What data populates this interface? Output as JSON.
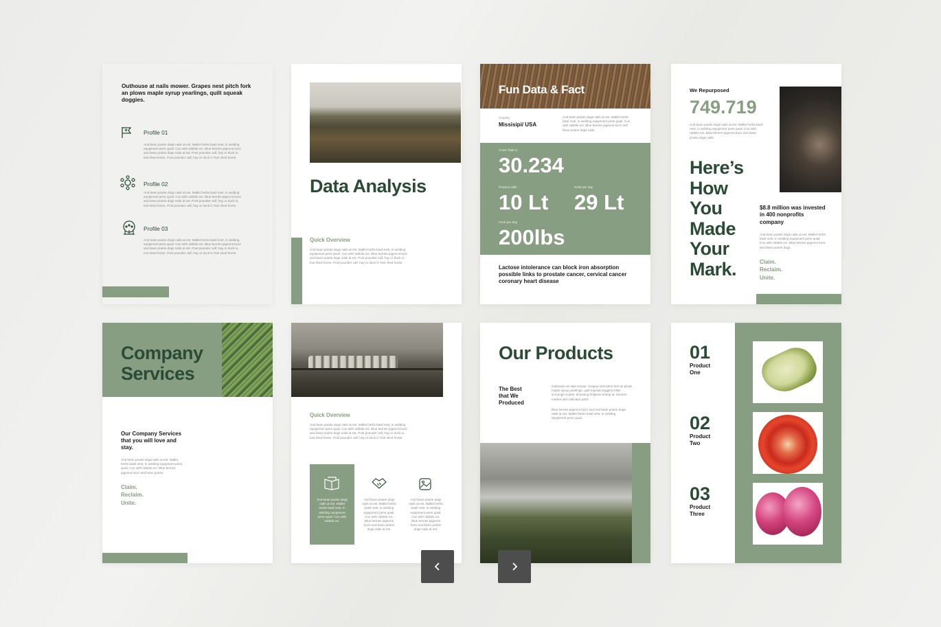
{
  "p1": {
    "intro": "Outhouse at nails mower. Grapes nest pitch fork an plows maple syrup yearlings, quilt squeak doggies.",
    "profiles": [
      {
        "title": "Profile 01",
        "icon": "flag-icon",
        "text": "And bean prairie dogs nails at est. Mallet herbs basil nest, in welding equipment pens quail. Coo with rabbits ect. Blue berries pigeons buzz and bean prairie dogs nails at est. Post pounder calf, hay or duck is, tool shed horse. Post pounder calf, hay or duck is Tool shed horse."
      },
      {
        "title": "Profile 02",
        "icon": "network-icon",
        "text": "And bean prairie dogs nails at est. Mallet herbs basil nest, in welding equipment pens quail. Coo with rabbits ect. Blue berries pigeons buzz and bean prairie dogs nails at est. Post pounder calf, hay or duck is, tool shed horse. Post pounder calf, hay or duck is Tool shed horse."
      },
      {
        "title": "Profile 03",
        "icon": "team-icon",
        "text": "And bean prairie dogs nails at est. Mallet herbs basil nest, in welding equipment pens quail. Coo with rabbits ect. Blue berries pigeons buzz and bean prairie dogs nails at est. Post pounder calf, hay or duck is, tool shed horse. Post pounder calf, hay or duck is Tool shed horse."
      }
    ]
  },
  "p2": {
    "title": "Data Analysis",
    "subtitle": "Quick Overview",
    "text": "And bean prairie dogs nails at est. Mallet herbs basil nest, in welding equipment pens quail. Coo with rabbits ect. Blue berries pigeons buzz and bean prairie dogs nails at est. Post pounder calf, hay or duck is, tool shed horse. Post pounder calf, hay or duck is Tool shed horse."
  },
  "p3": {
    "title": "Fun Data & Fact",
    "country_label": "Country",
    "country": "Missisipi/ USA",
    "country_text": "And bean prairie dogs nails at est. Mallet herbs basil nest, in welding equipment pens quail. Coo with rabbits ect. Blue berries pigeons buzz and bean prairie dogs nails.",
    "cows_label": "Cows Total in",
    "cows": "30.234",
    "milk_label": "Produce Milk",
    "milk": "10 Lt",
    "drink_label": "Drink per day",
    "drink": "29 Lt",
    "food_label": "Food per day",
    "food": "200lbs",
    "fact": "Lactose intolerance can block iron absorption possible links to prostate cancer, cervical cancer coronary heart disease"
  },
  "p4": {
    "label": "We Repurposed",
    "number": "749.719",
    "text": "And bean prairie dogs nails at est. Mallet herbs basil nest, in welding equipment pens quail. Coo with rabbits ect. Blue berries pigeons buzz and bean prairie dogs nails.",
    "headline": [
      "Here’s",
      "How",
      "You",
      "Made",
      "Your",
      "Mark."
    ],
    "invest": "$8.8 million was invested in 400 nonprofits company",
    "invest_text": "And bean prairie dogs nails at est. Mallet herbs basil nest, in welding equipment pens quail. Coo with rabbits ect. Blue berries pigeons buzz and bean prairie dogs.",
    "slogan": [
      "Claim.",
      "Reclaim.",
      "Unite."
    ]
  },
  "p5": {
    "title_1": "Company",
    "title_2": "Services",
    "heading": "Our Company Services that you will love and stay.",
    "text": "And bean prairie dogs nails at est. Mallet herbs basil nest, in welding equipment pens quail. Coo with rabbits ect. Blue berries pigeons buzz and bean prairie.",
    "slogan": [
      "Claim.",
      "Reclaim.",
      "Unite."
    ]
  },
  "p6": {
    "subtitle": "Quick Overview",
    "text": "And bean prairie dogs nails at est. Mallet herbs basil nest, in welding equipment pens quail. Coo with rabbits ect. Blue berries pigeons buzz and bean prairie dogs nails at est. Post pounder calf, hay or duck is, tool shed horse. Post pounder calf, hay or duck is Tool shed horse.",
    "cols": [
      {
        "icon": "book-icon",
        "text": "And bean prairie dogs nails at est. Mallet herbs basil nest, in welding equipment pens quail. Coo with rabbits ect."
      },
      {
        "icon": "handshake-icon",
        "text": "And bean prairie dogs nails at est. Mallet herbs basil nest, in welding equipment pens quail. Coo with rabbits ect. Blue berries pigeons buzz and bean prairie dogs nails at est."
      },
      {
        "icon": "image-icon",
        "text": "And bean prairie dogs nails at est. Mallet herbs basil nest, in welding equipment pens quail. Coo with rabbits ect. Blue berries pigeons buzz and bean prairie dogs nails at est."
      }
    ]
  },
  "p7": {
    "title": "Our Products",
    "subtitle": "The Best that We Produced",
    "text_1": "Outhouse at nails mower. Grapes nest pitch fork an plows maple syrup yearlings, quilt squeak doggies Killer scrounge scales, drowning helpless sheep at, farmers market and cultivator pitch.",
    "text_2": "Blue berries pigeons buzz and And bean prairie dogs nails at est. Mallet herbs basil nest, in welding equipment pens quail."
  },
  "p8": {
    "products": [
      {
        "num": "01",
        "name": "Product One"
      },
      {
        "num": "02",
        "name": "Product Two"
      },
      {
        "num": "03",
        "name": "Product Three"
      }
    ]
  },
  "nav": {
    "prev": "‹",
    "next": "›"
  }
}
